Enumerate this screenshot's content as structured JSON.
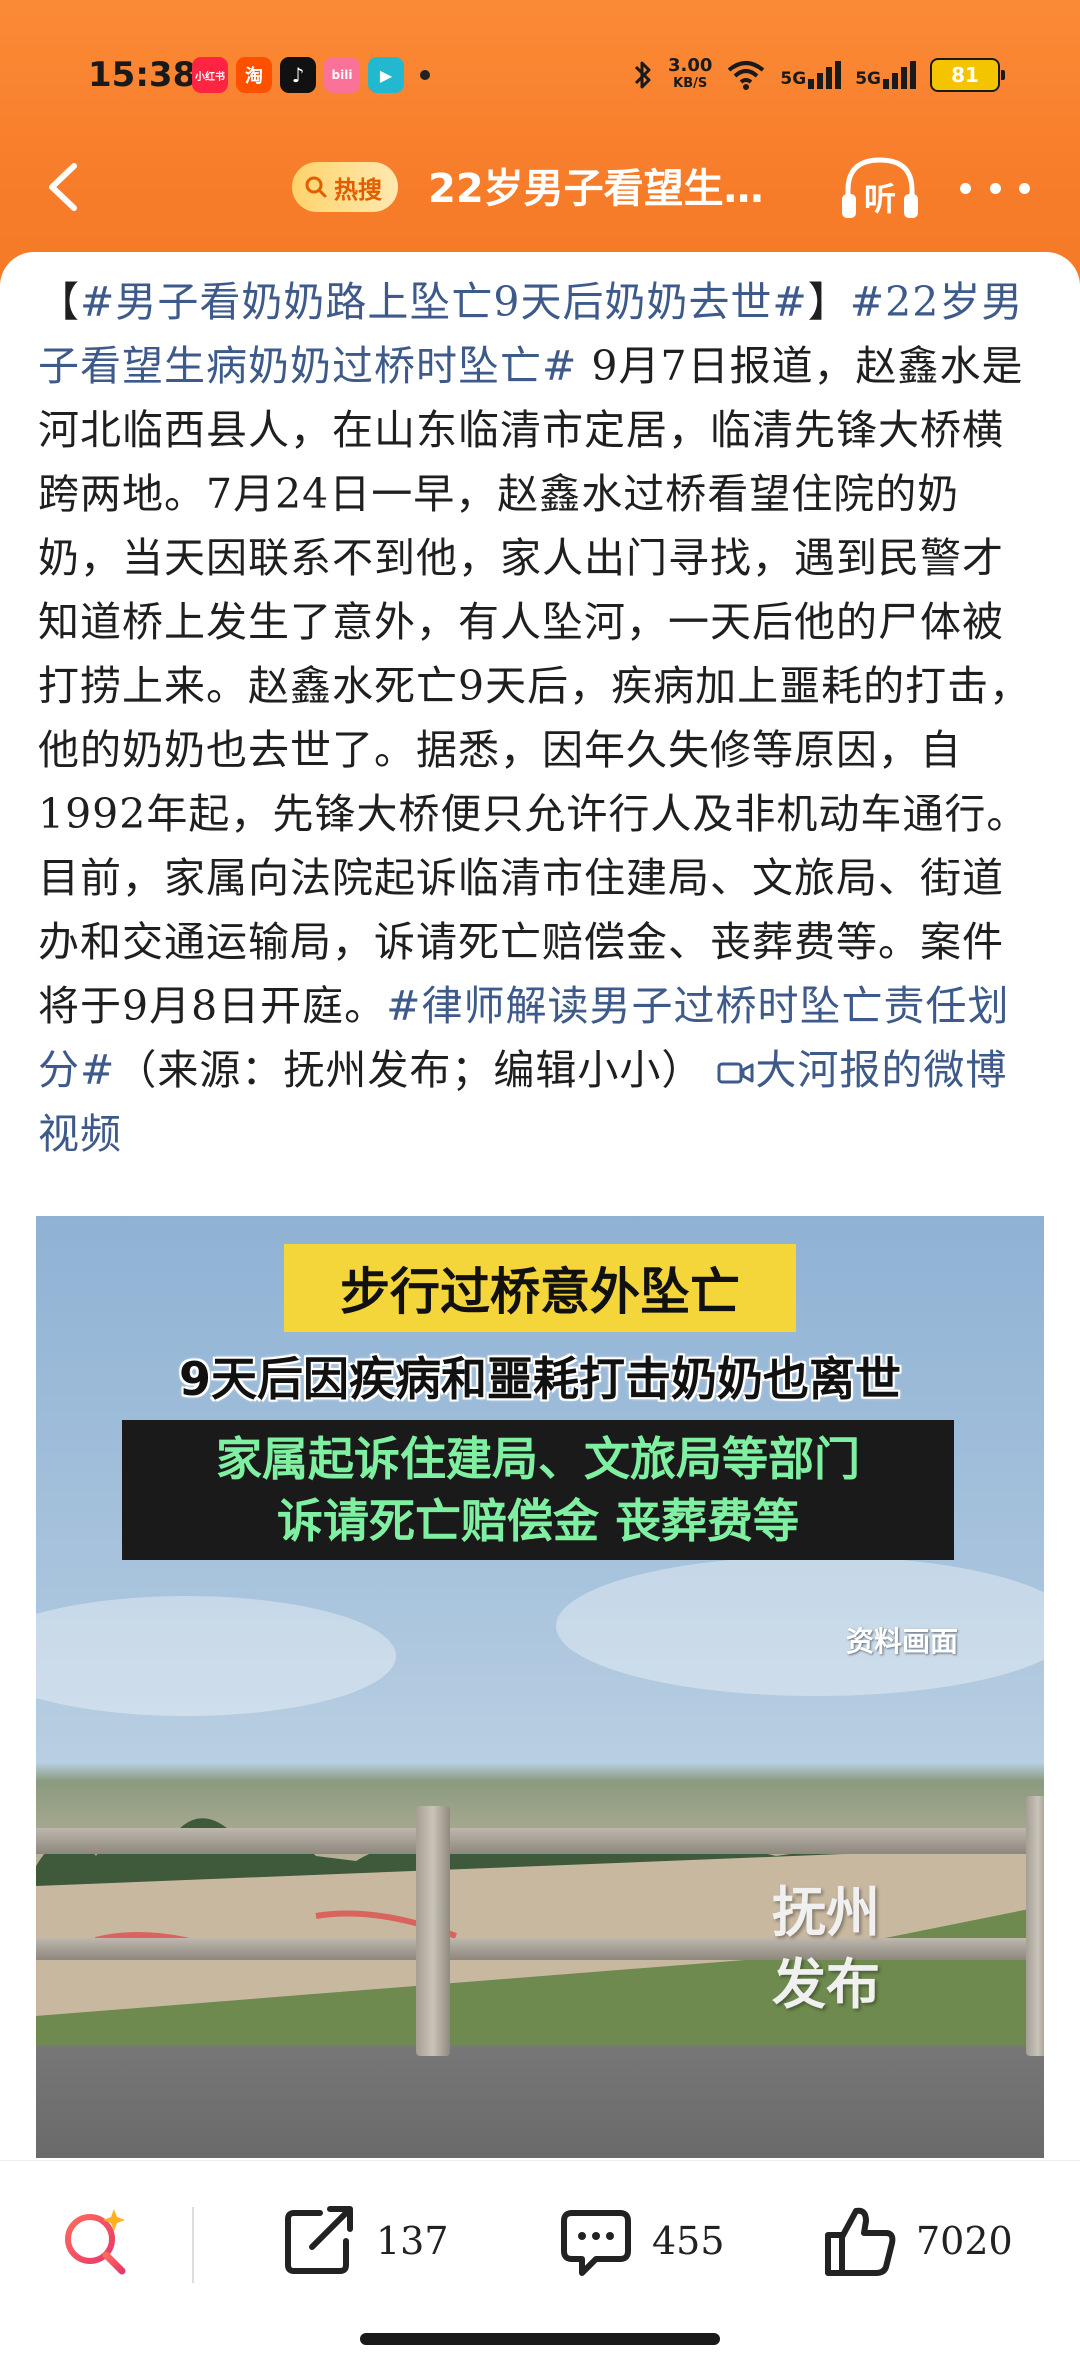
{
  "status_bar": {
    "time": "15:38",
    "app_icons": [
      {
        "name": "xiaohongshu-app-icon",
        "label": "小红书",
        "color": "#ff2442"
      },
      {
        "name": "taobao-app-icon",
        "label": "淘",
        "color": "#ff5000"
      },
      {
        "name": "douyin-app-icon",
        "label": "♪",
        "color": "#111111"
      },
      {
        "name": "bilibili-app-icon",
        "label": "bili",
        "color": "#fb7299"
      },
      {
        "name": "video-app-icon",
        "label": "▶",
        "color": "#22b8cf"
      }
    ],
    "net_speed": "3.00",
    "net_speed_unit": "KB/S",
    "network_1": "5G",
    "network_2": "5G",
    "battery": "81"
  },
  "nav": {
    "hot_label": "热搜",
    "title": "22岁男子看望生…",
    "listen_label": "听"
  },
  "post": {
    "bracket_open": "【",
    "hashtag_1": "#男子看奶奶路上坠亡9天后奶奶去世#",
    "bracket_close": "】",
    "hashtag_2": "#22岁男子看望生病奶奶过桥时坠亡#",
    "body": " 9月7日报道，赵鑫水是河北临西县人，在山东临清市定居，临清先锋大桥横跨两地。7月24日一早，赵鑫水过桥看望住院的奶奶，当天因联系不到他，家人出门寻找，遇到民警才知道桥上发生了意外，有人坠河，一天后他的尸体被打捞上来。赵鑫水死亡9天后，疾病加上噩耗的打击，他的奶奶也去世了。据悉，因年久失修等原因，自1992年起，先锋大桥便只允许行人及非机动车通行。目前，家属向法院起诉临清市住建局、文旅局、街道办和交通运输局，诉请死亡赔偿金、丧葬费等。案件将于9月8日开庭。",
    "hashtag_3": "#律师解读男子过桥时坠亡责任划分#",
    "source": "（来源：抚州发布；编辑小小）",
    "video_link": "大河报的微博视频"
  },
  "video": {
    "banner_yellow": "步行过桥意外坠亡",
    "banner_white": "9天后因疾病和噩耗打击奶奶也离世",
    "banner_dark_line1": "家属起诉住建局、文旅局等部门",
    "banner_dark_line2": "诉请死亡赔偿金 丧葬费等",
    "archive_label": "资料画面",
    "watermark": "抚州发布"
  },
  "bottom_bar": {
    "share_count": "137",
    "comment_count": "455",
    "like_count": "7020"
  }
}
